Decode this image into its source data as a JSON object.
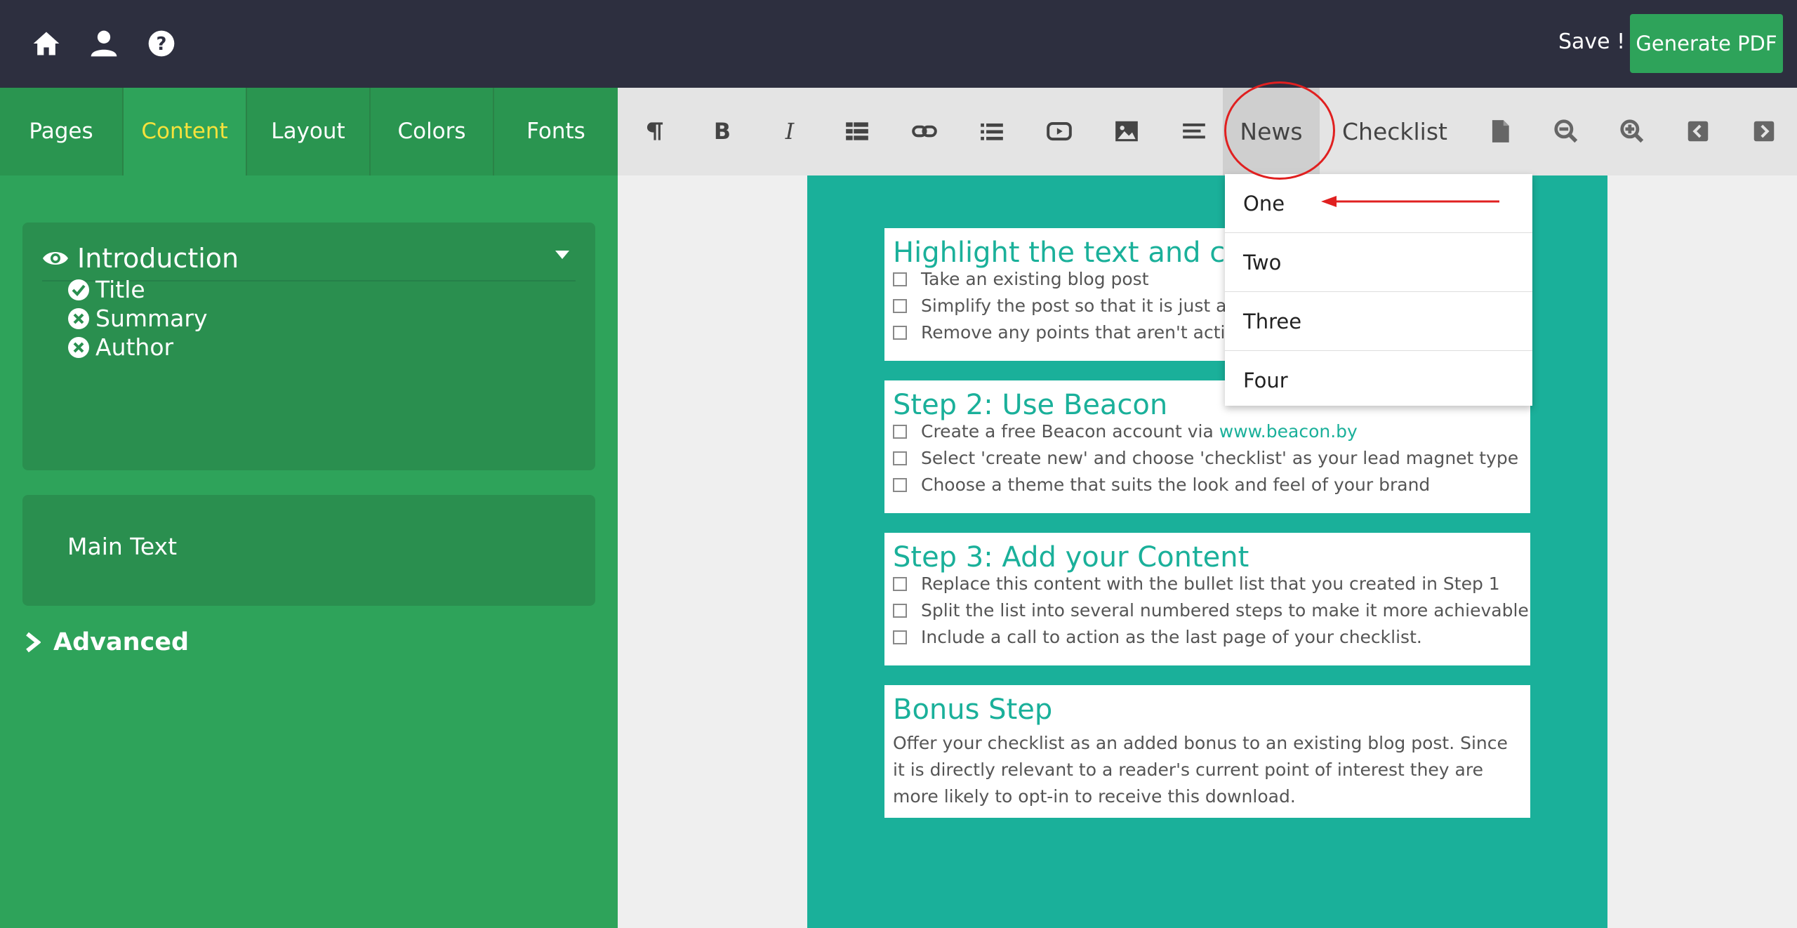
{
  "topbar": {
    "icons": [
      "home-icon",
      "user-icon",
      "help-icon"
    ],
    "save_label": "Save !",
    "pdf_label": "Generate PDF"
  },
  "sidebar": {
    "tabs": [
      {
        "label": "Pages"
      },
      {
        "label": "Content"
      },
      {
        "label": "Layout"
      },
      {
        "label": "Colors"
      },
      {
        "label": "Fonts"
      }
    ],
    "active_tab": "Content",
    "section": {
      "title": "Introduction",
      "fields": [
        {
          "label": "Title",
          "state": "checked"
        },
        {
          "label": "Summary",
          "state": "removed"
        },
        {
          "label": "Author",
          "state": "removed"
        }
      ]
    },
    "main_text": "Main Text",
    "advanced": "Advanced"
  },
  "toolbar": {
    "icons": [
      "paragraph-icon",
      "bold-icon",
      "italic-icon",
      "table-icon",
      "link-icon",
      "list-icon",
      "video-icon",
      "image-icon",
      "align-icon",
      "page-icon",
      "zoom-out-icon",
      "zoom-in-icon",
      "prev-icon",
      "next-icon"
    ],
    "news_label": "News",
    "checklist_label": "Checklist"
  },
  "dropdown": {
    "items": [
      "One",
      "Two",
      "Three",
      "Four"
    ]
  },
  "document": {
    "steps": [
      {
        "title": "Highlight the text and ch",
        "items": [
          "Take an existing blog post",
          "Simplify the post so that it is just a ser",
          "Remove any points that aren't actiona"
        ]
      },
      {
        "title": "Step 2: Use Beacon",
        "item1_prefix": "Create a free Beacon account via ",
        "item1_link": "www.beacon.by",
        "items": [
          "Select 'create new' and choose 'checklist' as your lead magnet type",
          "Choose a theme that suits the look and feel of your brand"
        ]
      },
      {
        "title": "Step 3: Add your Content",
        "items": [
          "Replace this content with the bullet list that you created in Step 1",
          "Split the list into several numbered steps to make it more achievable",
          "Include a call to action as the last page of your checklist."
        ]
      }
    ],
    "bonus": {
      "title": "Bonus Step",
      "text": "Offer your checklist as an added bonus to an existing blog post. Since it is directly relevant to a reader's current point of interest they are more likely to opt-in to receive this download."
    }
  },
  "colors": {
    "topbar": "#2d2f3f",
    "sidebar": "#2ea35a",
    "active_tab_text": "#f5e23c",
    "page_teal": "#1ab09a",
    "annotation_red": "#e02020"
  }
}
